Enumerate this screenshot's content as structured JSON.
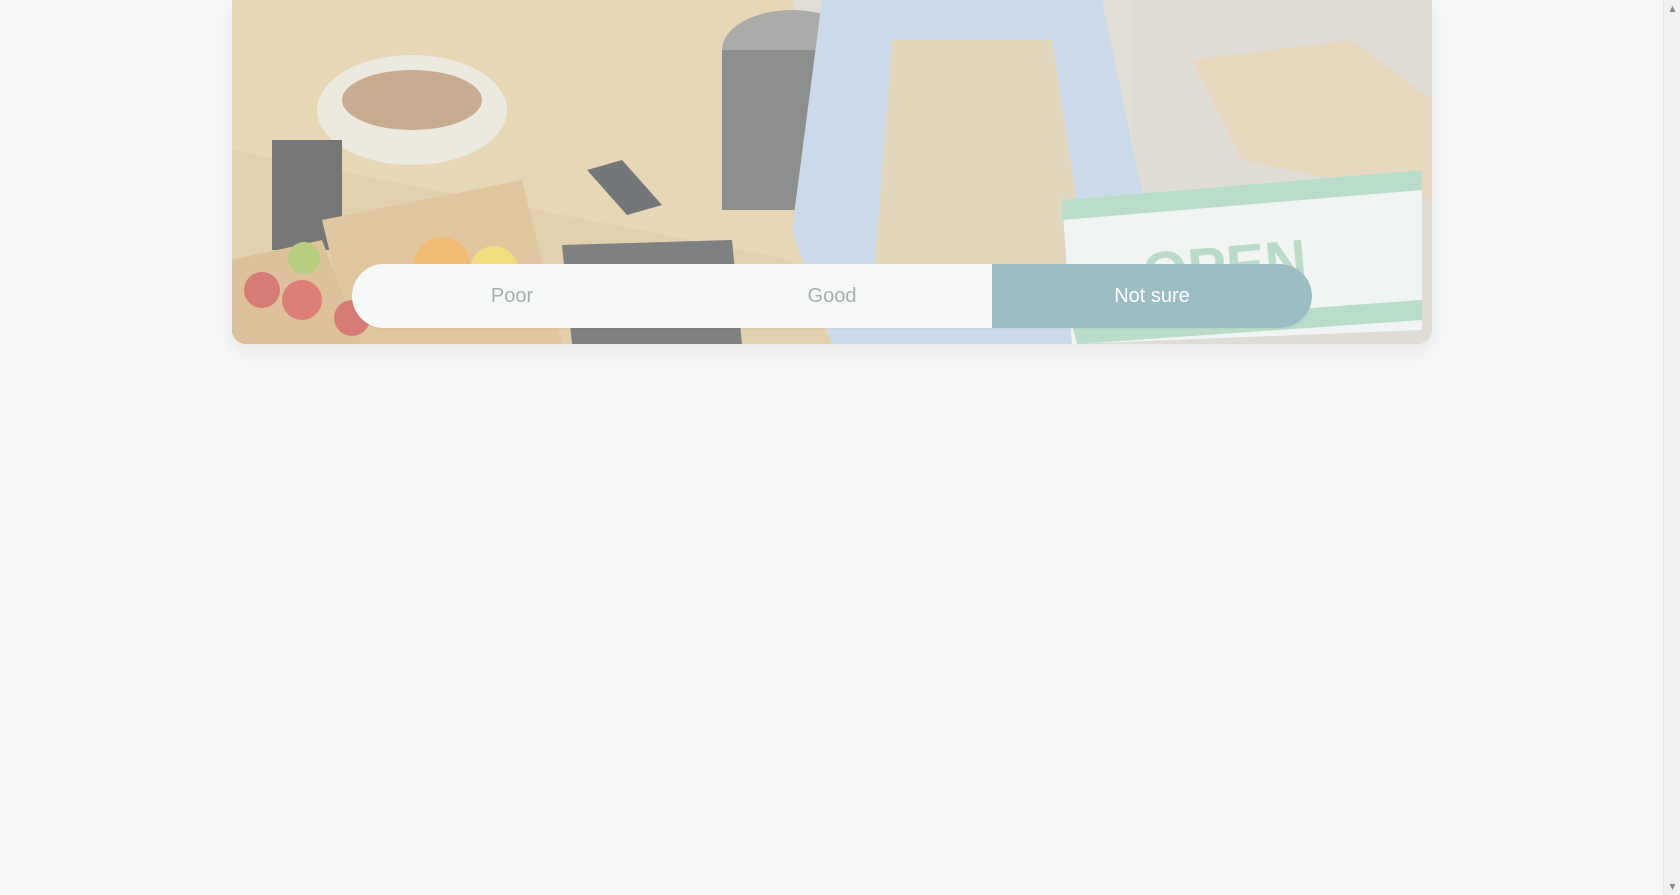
{
  "hero": {
    "image_alt": "Shop owner in apron holding an OPEN sign behind a counter with fruit and cookies",
    "sign_text": "OPEN"
  },
  "rating": {
    "options": [
      {
        "label": "Poor",
        "selected": false
      },
      {
        "label": "Good",
        "selected": false
      },
      {
        "label": "Not sure",
        "selected": true
      }
    ]
  },
  "colors": {
    "page_background": "#f6f7f9",
    "selected_option": "#9abcc3",
    "unselected_text": "#a8adb0"
  },
  "scrollbar": {
    "up_icon": "scroll-up-arrow-icon",
    "down_icon": "scroll-down-arrow-icon"
  }
}
